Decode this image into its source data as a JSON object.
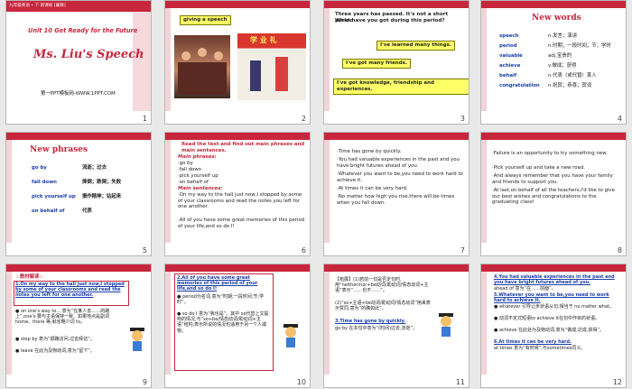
{
  "colors": {
    "accent": "#c8263c",
    "blue": "#1a3ea8",
    "highlight": "#ffff66"
  },
  "slides": [
    {
      "num": "1",
      "corner": "九年级英语 • 下   新课标 [冀教]",
      "unit": "Unit 10  Get Ready for the Future",
      "title": "Ms. Liu's Speech",
      "site": "第一PPT模板网-WWW.1PPT.COM"
    },
    {
      "num": "2",
      "label": "giving a speech",
      "banner": "学 业 礼"
    },
    {
      "num": "3",
      "q1": "Three years has passed. It's not a short period.",
      "q2": "What have you got during this period?",
      "a1": "I've learned many things.",
      "a2": "I've got many friends.",
      "a3": "I've got knowledge, friendship and experiences."
    },
    {
      "num": "4",
      "title": "New words",
      "words": [
        {
          "w": "speech",
          "m": "n.发言；演讲"
        },
        {
          "w": "period",
          "m": "n.时期；一段时间；节；学时"
        },
        {
          "w": "valuable",
          "m": "adj.宝贵的"
        },
        {
          "w": "achieve",
          "m": "v.做成；获得"
        },
        {
          "w": "behalf",
          "m": "n.代表（或代替）某人"
        },
        {
          "w": "congratulation",
          "m": "n.祝贺；恭喜；贺词"
        }
      ]
    },
    {
      "num": "5",
      "title": "New phrases",
      "phrases": [
        {
          "p": "go by",
          "m": "流逝；过去"
        },
        {
          "p": "fall down",
          "m": "摔倒；跌倒；失败"
        },
        {
          "p": "pick yourself up",
          "m": "振作精神；站起来"
        },
        {
          "p": "on behalf of",
          "m": "代表"
        }
      ]
    },
    {
      "num": "6",
      "heading": "Read the text and find out main phrases and main sentences.",
      "mp": "Main phrases:",
      "p1": "·go by",
      "p2": "·fall down",
      "p3": "·pick yourself up",
      "p4": "·on behalf of",
      "ms": "Main sentences:",
      "s1": "·On my way to the hall just now,I stopped by some of your classrooms and read the notes you left for one another.",
      "s2": "·All of you have some great memories of this period of your life,and so do I!"
    },
    {
      "num": "7",
      "l1": "·Time has gone by quickly.",
      "l2": "·You had valuable experiences in the past and you have bright futures ahead of you.",
      "l3": "·Whatever you want to be,you need to work hard to achieve it.",
      "l4": "·At times it can be very hard.",
      "l5": "·No matter how high you rise,there will be times when you fall down."
    },
    {
      "num": "8",
      "l1": "·Failure is an opportunity to try something new.",
      "l2": "·Pick yourself up and take a new road.",
      "l3": "·And always remember that you have your family and friends to support you.",
      "l4": "·At last,on behalf of all the teachers,I'd like to give our best wishes and congratulations to the graduating class!"
    },
    {
      "num": "9",
      "tag": "☆教材解读☆",
      "h": "1.On my way to the hall just now,I stopped by some of your classrooms and read the notes you left for one another.",
      "b1": "● on one's way to... 意为“在某人去……的路上”,one's 要与主语保持一致。如果地点是副词 home、there 等,就省略介词 to。",
      "b2": "● stop by 意为“顺路访问,过去拜访”。",
      "b3": "● leave 在此为及物动词,意为“留下”。"
    },
    {
      "num": "10",
      "h": "2.All of you have some great memories of this period of your life,and so do I!",
      "b1": "● period为名词,意为“时期;一段时间;节;学时”。",
      "b2": "● so do I 意为“我也是”。其中 so代替上文提到的情况,与“so+be/情态动词/助动词+主语”结构,表示所说的情况也适用于另一个人或物。"
    },
    {
      "num": "11",
      "b1": "【拓展】(1)若前一句是否定句时,用“neither/nor+be动词/助动词/情态动词+主语”表示“……也不……”。",
      "b2": "(2)“so+主语+be动词/助动词/情态动词”用来表示赞同,意为“的确如此”。",
      "h": "3.Time has gone by quickly.",
      "b3": "go by 在本句中意为“(时间)过去,流逝”。"
    },
    {
      "num": "12",
      "h1": "4.You had valuable experiences in the past and you have bright futures ahead of you.",
      "b1": "ahead of 意为“在……前面”。",
      "h2": "5.Whatever you want to be,you need to work hard to achieve it.",
      "b2": "● whatever 引导让步状语从句,相当于 no matter what。",
      "b3": "● 动词不定式短语to achieve it在句中作目的状语。",
      "b4": "● achieve 在此处为及物动词,意为“做成;达成,获得”。",
      "h3": "6.At times it can be very hard.",
      "b5": "at times 意为“有时候”,与sometimes同义。"
    }
  ]
}
